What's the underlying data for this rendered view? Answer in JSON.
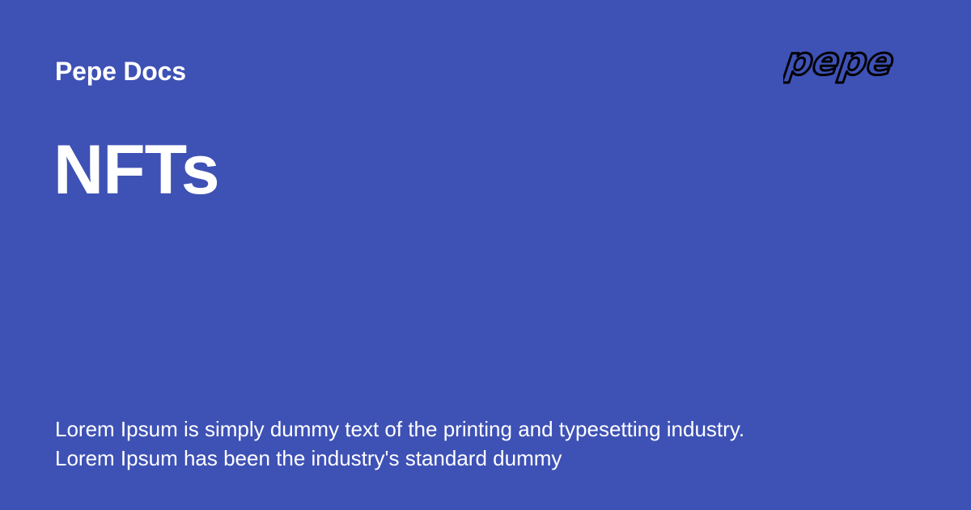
{
  "colors": {
    "background": "#3E51B5",
    "text": "#FFFFFF",
    "logo_stroke": "#000000"
  },
  "header": {
    "site_name": "Pepe Docs",
    "logo_text": "pepe",
    "logo_icon": "pepe-wordmark-logo"
  },
  "main": {
    "title": "NFTs",
    "description": "Lorem Ipsum is simply dummy text of the printing and typesetting industry. Lorem Ipsum has been the industry's standard dummy"
  }
}
